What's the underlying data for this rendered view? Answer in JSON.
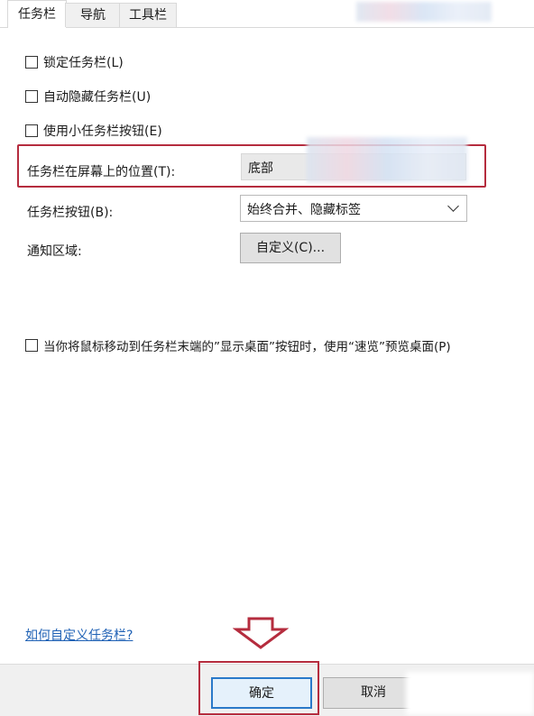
{
  "tabs": [
    {
      "label": "任务栏",
      "active": true
    },
    {
      "label": "导航",
      "active": false
    },
    {
      "label": "工具栏",
      "active": false
    }
  ],
  "options": {
    "lock_taskbar": "锁定任务栏(L)",
    "auto_hide": "自动隐藏任务栏(U)",
    "small_buttons": "使用小任务栏按钮(E)"
  },
  "position": {
    "label": "任务栏在屏幕上的位置(T):",
    "value": "底部"
  },
  "buttons_setting": {
    "label": "任务栏按钮(B):",
    "value": "始终合并、隐藏标签"
  },
  "notification": {
    "label": "通知区域:",
    "customize_button": "自定义(C)..."
  },
  "peek_option": "当你将鼠标移动到任务栏末端的”显示桌面”按钮时，使用“速览”预览桌面(P)",
  "help_link": "如何自定义任务栏?",
  "footer": {
    "ok_button": "确定",
    "cancel_button": "取消"
  },
  "colors": {
    "highlight": "#b52c3e",
    "link": "#1f61b5",
    "focus": "#2a79c9"
  },
  "icons": {
    "annotation_arrow": "down-arrow-icon",
    "dropdown": "chevron-down-icon"
  }
}
